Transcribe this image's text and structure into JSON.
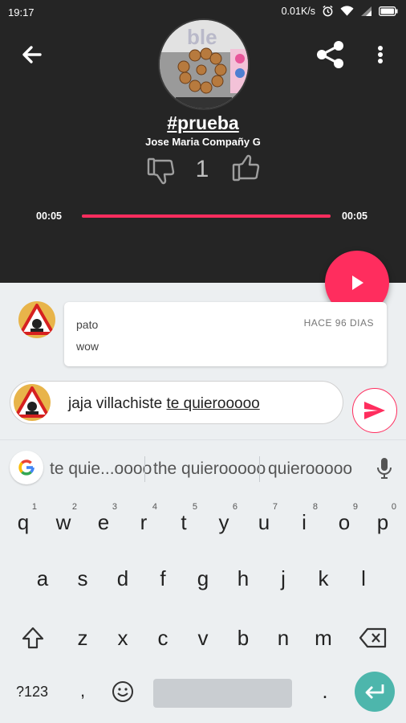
{
  "status_bar": {
    "time": "19:17",
    "speed": "0.01K/s"
  },
  "track": {
    "title": "#prueba",
    "author": "Jose Maria Compañy G",
    "votes": "1",
    "time_current": "00:05",
    "time_total": "00:05",
    "progress": 1.0
  },
  "comment": {
    "user": "pato",
    "date": "HACE 96 DIAS",
    "text": "wow"
  },
  "input": {
    "text_plain": "jaja villachiste ",
    "text_underlined": "te quierooooo"
  },
  "keyboard": {
    "suggestions": [
      "te quie...oooo",
      "the quierooooo",
      "quierooooo"
    ],
    "row1": [
      {
        "key": "q",
        "hint": "1"
      },
      {
        "key": "w",
        "hint": "2"
      },
      {
        "key": "e",
        "hint": "3"
      },
      {
        "key": "r",
        "hint": "4"
      },
      {
        "key": "t",
        "hint": "5"
      },
      {
        "key": "y",
        "hint": "6"
      },
      {
        "key": "u",
        "hint": "7"
      },
      {
        "key": "i",
        "hint": "8"
      },
      {
        "key": "o",
        "hint": "9"
      },
      {
        "key": "p",
        "hint": "0"
      }
    ],
    "row2": [
      "a",
      "s",
      "d",
      "f",
      "g",
      "h",
      "j",
      "k",
      "l"
    ],
    "row3": [
      "z",
      "x",
      "c",
      "v",
      "b",
      "n",
      "m"
    ],
    "symbols_label": "?123",
    "period": "."
  },
  "colors": {
    "accent": "#ff2d5e",
    "dark_bg": "#252525",
    "enter_key": "#4db6ac"
  }
}
